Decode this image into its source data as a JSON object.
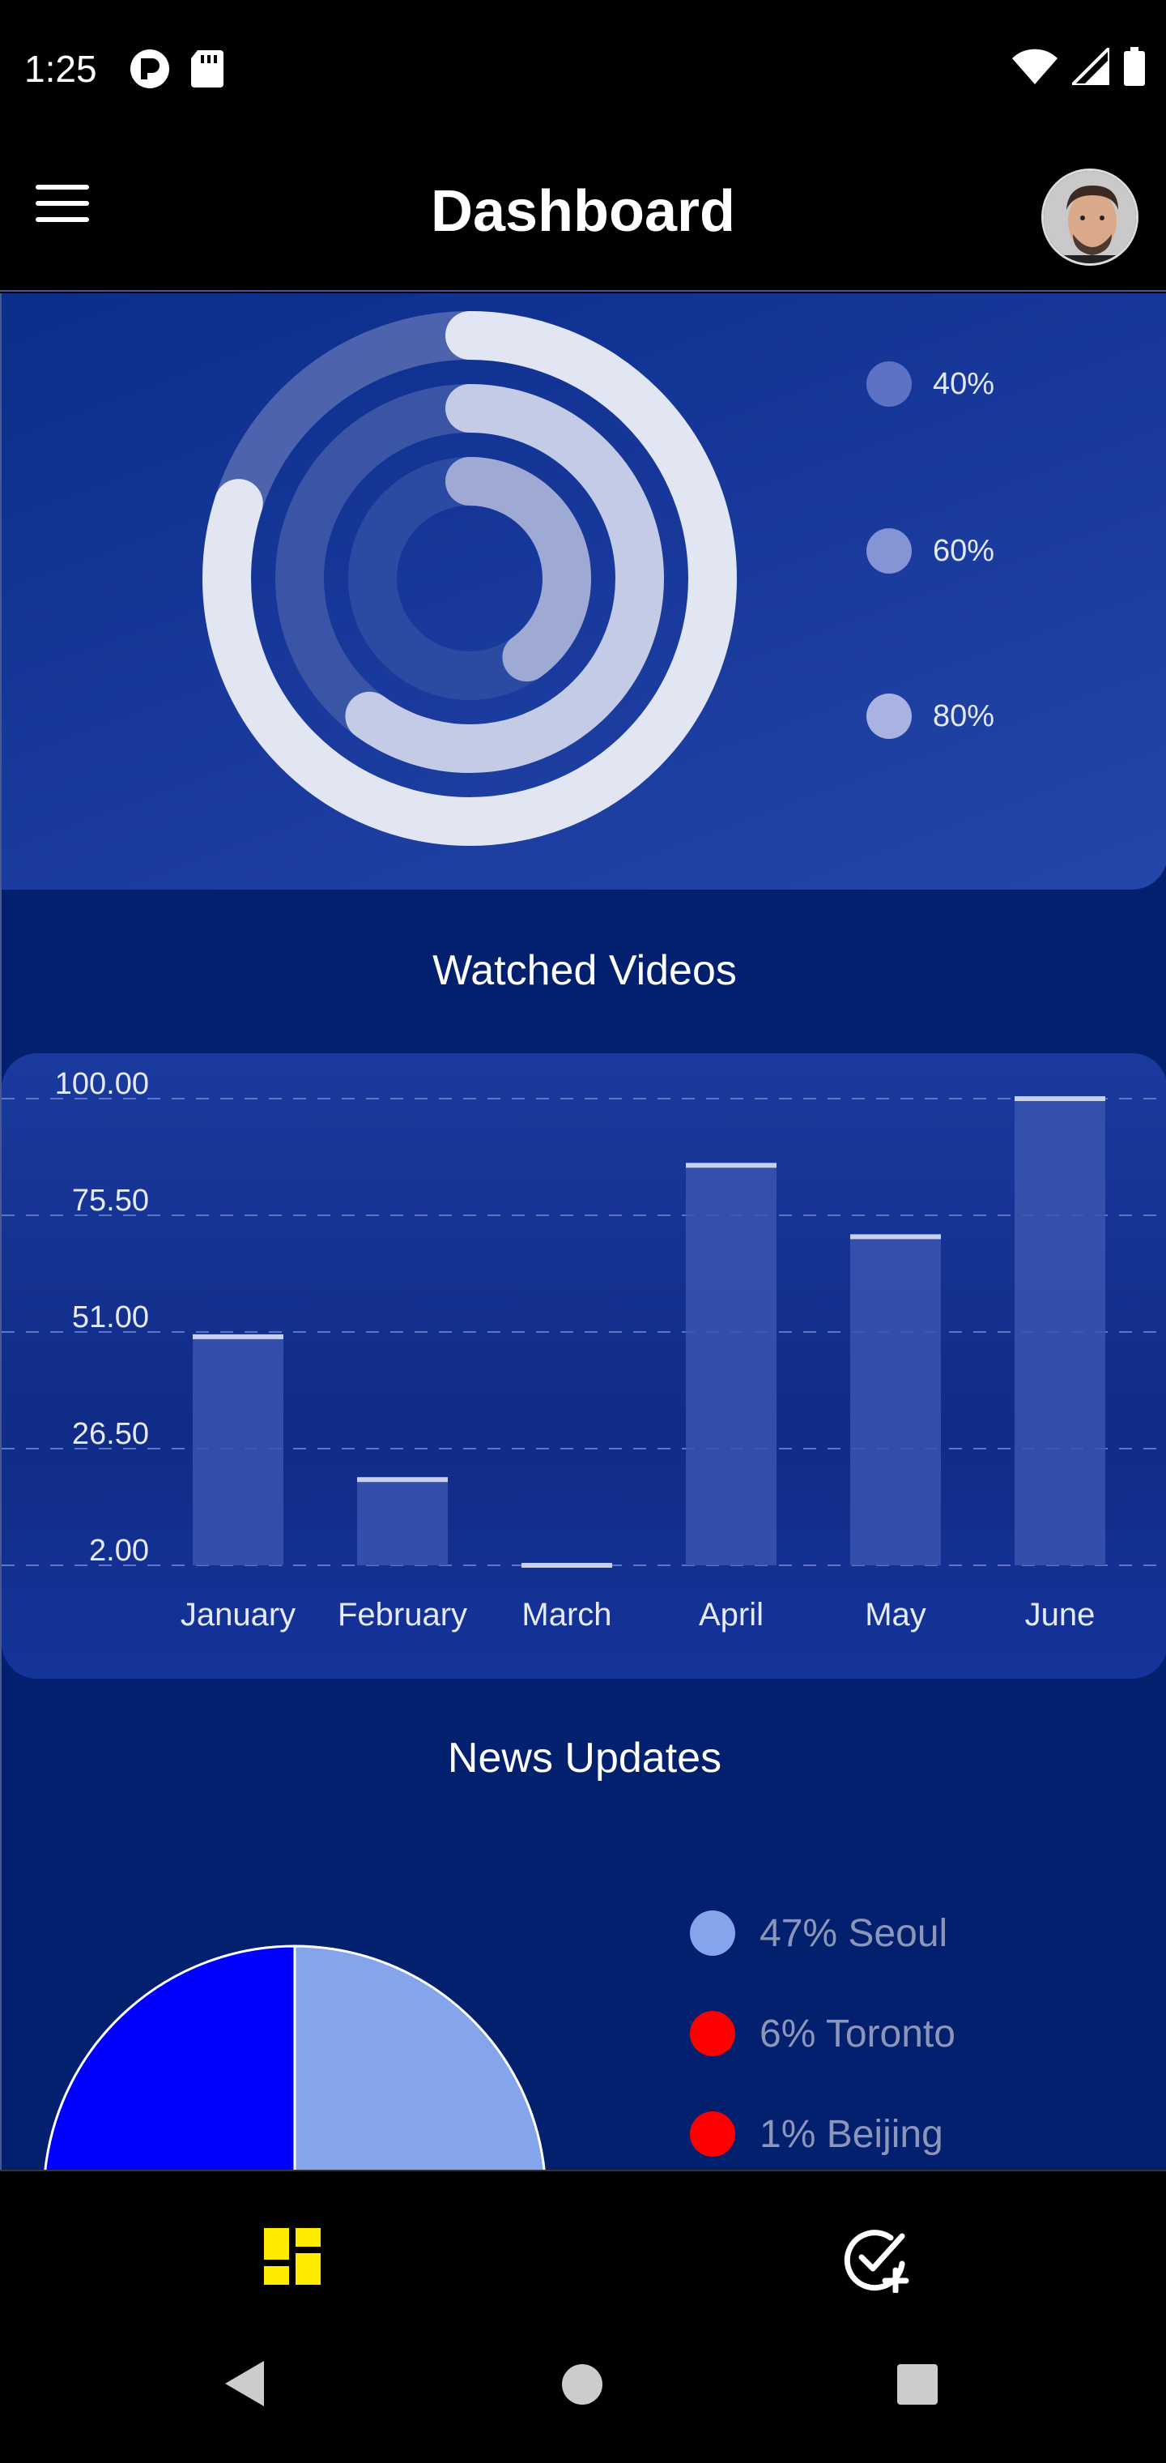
{
  "status_bar": {
    "time": "1:25",
    "left_icons": [
      "p-logo-icon",
      "sd-card-icon"
    ],
    "right_icons": [
      "wifi-icon",
      "cellular-signal-icon",
      "battery-icon"
    ]
  },
  "app_bar": {
    "title": "Dashboard",
    "menu_icon": "hamburger-menu-icon",
    "avatar": "user-avatar"
  },
  "radial_chart": {
    "legend": [
      {
        "label": "40%",
        "color": "#5d72c2"
      },
      {
        "label": "60%",
        "color": "#8494d4"
      },
      {
        "label": "80%",
        "color": "#a8b3e2"
      }
    ],
    "rings": [
      {
        "value": 0.8,
        "color": "#e2e6f3",
        "track": "#4d63ae"
      },
      {
        "value": 0.6,
        "color": "#c4cbe6",
        "track": "#3a54a6"
      },
      {
        "value": 0.4,
        "color": "#9eaad4",
        "track": "#2b4ba2"
      }
    ]
  },
  "watched_videos": {
    "title": "Watched Videos"
  },
  "news_updates": {
    "title": "News Updates",
    "legend": [
      {
        "label": "47% Seoul",
        "color": "#84a4ec"
      },
      {
        "label": "6% Toronto",
        "color": "#ff0000"
      },
      {
        "label": "1% Beijing",
        "color": "#ff0000"
      }
    ]
  },
  "chart_data": {
    "type": "bar",
    "categories": [
      "January",
      "February",
      "March",
      "April",
      "May",
      "June"
    ],
    "values": [
      50,
      20,
      2,
      86,
      71,
      100
    ],
    "y_ticks": [
      "100.00",
      "75.50",
      "51.00",
      "26.50",
      "2.00"
    ],
    "ylim": [
      2,
      100
    ],
    "grid": true,
    "bar_color": "#3a55b0",
    "cap_color": "#c8d0ee"
  },
  "pie_chart": {
    "type": "pie",
    "slices": [
      {
        "label": "Seoul",
        "value": 47,
        "color": "#84a4ec"
      },
      {
        "label": "Toronto",
        "value": 6,
        "color": "#ff0000"
      },
      {
        "label": "Beijing",
        "value": 1,
        "color": "#ff0000"
      },
      {
        "label": "",
        "value": 46,
        "color": "#0000ff"
      }
    ]
  },
  "bottom_nav": {
    "items": [
      {
        "icon": "dashboard-icon",
        "color": "#ffeb00",
        "active": true
      },
      {
        "icon": "add-task-icon",
        "color": "#ffffff",
        "active": false
      }
    ]
  },
  "system_nav": {
    "buttons": [
      "back-icon",
      "home-icon",
      "recents-icon"
    ]
  }
}
